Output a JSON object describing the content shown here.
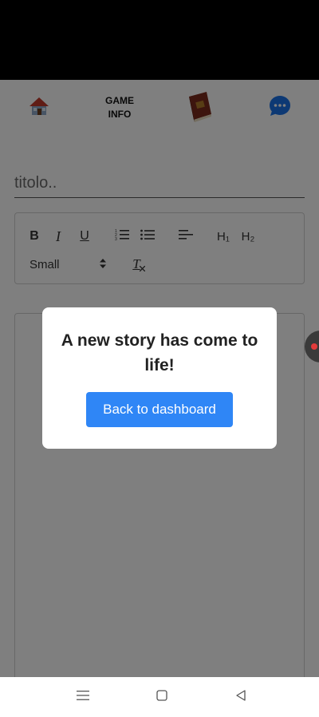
{
  "header": {
    "home_icon": "house-icon",
    "game_info_line1": "GAME",
    "game_info_line2": "INFO",
    "book_icon": "book-icon",
    "chat_icon": "chat-bubble-icon"
  },
  "title_field": {
    "placeholder": "titolo..",
    "value": ""
  },
  "toolbar": {
    "bold": "B",
    "italic": "I",
    "underline": "U",
    "ordered_list_icon": "ordered-list-icon",
    "bullet_list_icon": "bullet-list-icon",
    "align_icon": "align-left-icon",
    "h1": "H₁",
    "h2": "H₂",
    "size_select": "Small",
    "clear_format": "T"
  },
  "modal": {
    "title": "A new story has come to life!",
    "button_label": "Back to dashboard"
  },
  "colors": {
    "accent": "#2f86f6",
    "overlay": "rgba(0,0,0,0.5)",
    "chat_icon": "#1a73e8",
    "record_dot": "#e23b3b"
  },
  "nav": {
    "menu_icon": "menu-icon",
    "home_icon": "square-home-icon",
    "back_icon": "triangle-back-icon"
  }
}
